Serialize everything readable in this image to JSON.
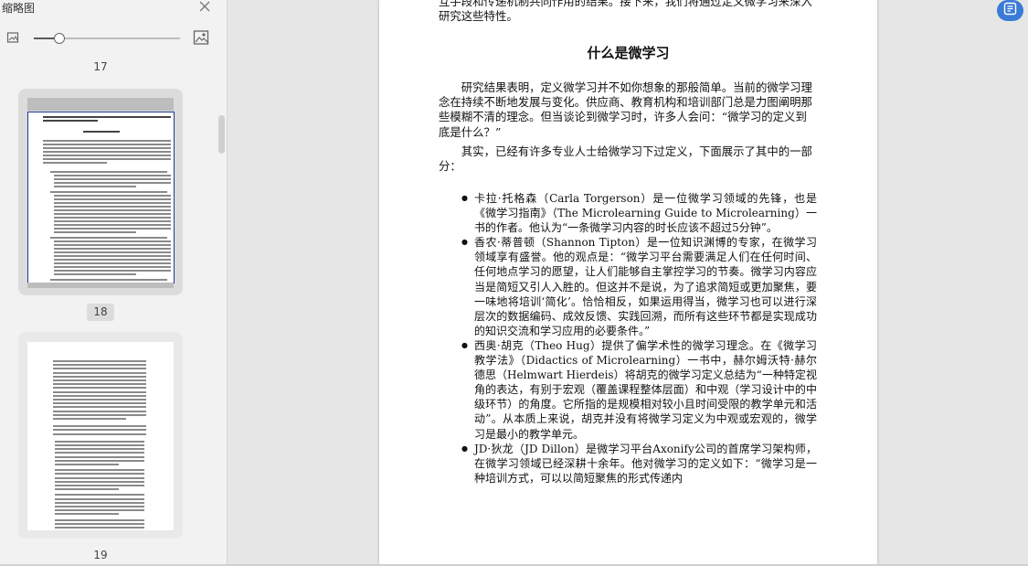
{
  "panel": {
    "title": "缩略图",
    "zoom_value": 0.17,
    "pages": [
      {
        "number": "17"
      },
      {
        "number": "18",
        "selected": true
      },
      {
        "number": "19"
      }
    ]
  },
  "document": {
    "intro": "互手段和传递机制共同作用的结果。接下来，我们将通过定义微学习来深入研究这些特性。",
    "heading": "什么是微学习",
    "paragraphs": [
      "研究结果表明，定义微学习并不如你想象的那般简单。当前的微学习理念在持续不断地发展与变化。供应商、教育机构和培训部门总是力图阐明那些模糊不清的理念。但当谈论到微学习时，许多人会问：“微学习的定义到底是什么？”",
      "其实，已经有许多专业人士给微学习下过定义，下面展示了其中的一部分："
    ],
    "bullets": [
      "卡拉·托格森（Carla Torgerson）是一位微学习领域的先锋，也是《微学习指南》（The Microlearning Guide to Microlearning）一书的作者。他认为“一条微学习内容的时长应该不超过5分钟”。",
      "香农·蒂普顿（Shannon Tipton）是一位知识渊博的专家，在微学习领域享有盛誉。他的观点是：“微学习平台需要满足人们在任何时间、任何地点学习的愿望，让人们能够自主掌控学习的节奏。微学习内容应当是简短又引人入胜的。但这并不是说，为了追求简短或更加聚焦，要一味地将培训‘简化’。恰恰相反，如果运用得当，微学习也可以进行深层次的数据编码、成效反馈、实践回溯，而所有这些环节都是实现成功的知识交流和学习应用的必要条件。”",
      "西奥·胡克（Theo Hug）提供了偏学术性的微学习理念。在《微学习教学法》（Didactics of Microlearning）一书中，赫尔姆沃特·赫尔德思（Helmwart Hierdeis）将胡克的微学习定义总结为“一种特定视角的表达，有别于宏观（覆盖课程整体层面）和中观（学习设计中的中级环节）的角度。它所指的是规模相对较小且时间受限的教学单元和活动”。从本质上来说，胡克并没有将微学习定义为中观或宏观的，微学习是最小的教学单元。",
      "JD·狄龙（JD Dillon）是微学习平台Axonify公司的首席学习架构师，在微学习领域已经深耕十余年。他对微学习的定义如下：“微学习是一种培训方式，可以以简短聚焦的形式传递内"
    ]
  },
  "toolbar": {
    "corner_button_icon": "doc-convert-icon",
    "accent_color": "#3a7bd5"
  }
}
